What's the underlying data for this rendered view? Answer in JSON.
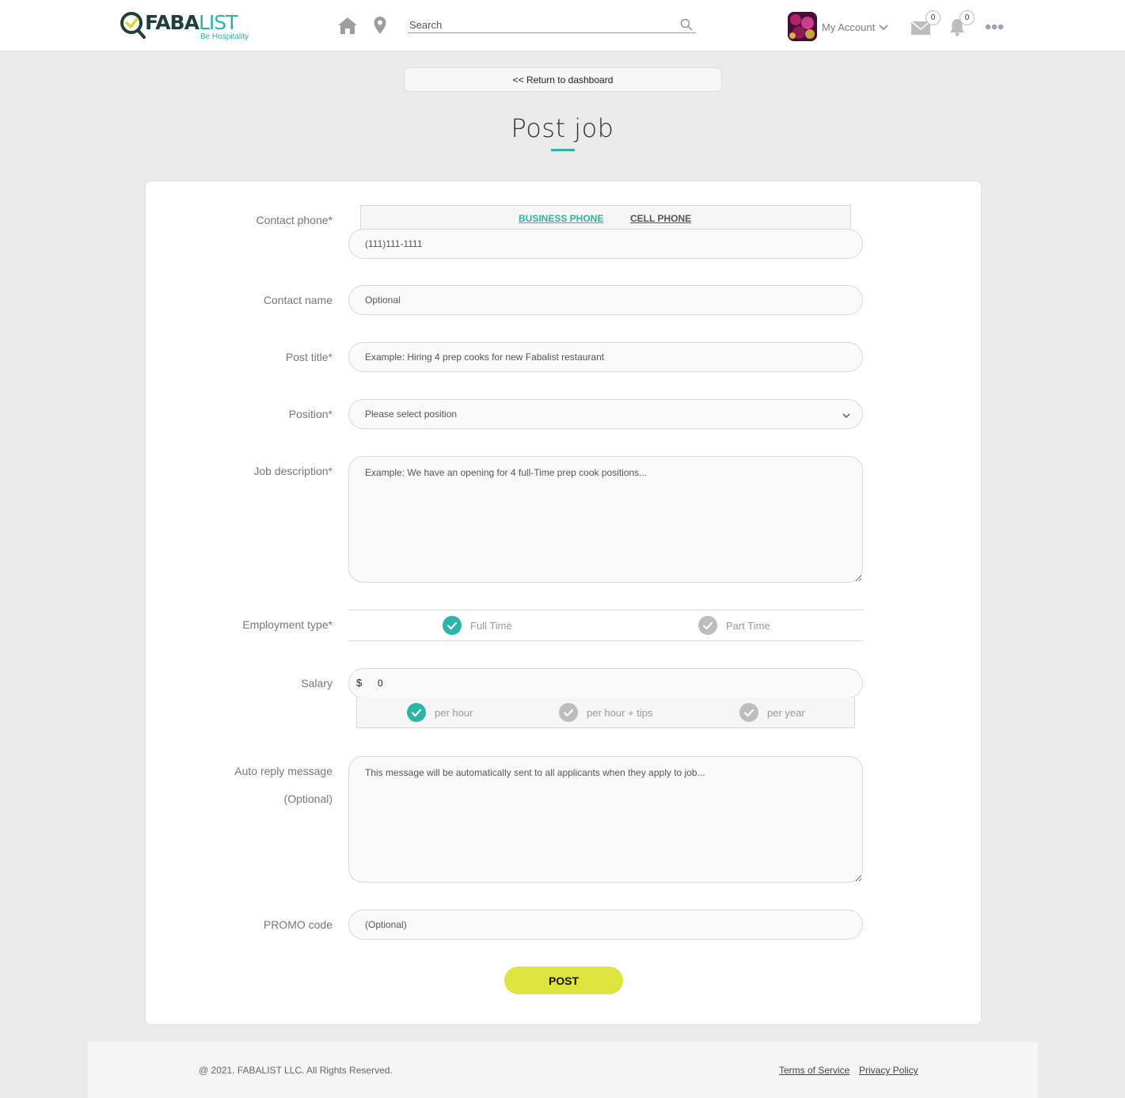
{
  "brand": {
    "name_main": "FABA",
    "name_accent": "LIST",
    "tagline": "Be Hospitality"
  },
  "header": {
    "search_placeholder": "Search",
    "account_label": "My Account",
    "messages_count": "0",
    "notifications_count": "0"
  },
  "return_label": "<< Return to dashboard",
  "page_title": "Post job",
  "form": {
    "contact_phone": {
      "label": "Contact phone*",
      "tabs": [
        "BUSINESS PHONE",
        "CELL PHONE"
      ],
      "active_tab": "BUSINESS PHONE",
      "placeholder": "(111)111-1111"
    },
    "contact_name": {
      "label": "Contact name",
      "placeholder": "Optional"
    },
    "post_title": {
      "label": "Post title*",
      "placeholder": "Example: Hiring 4 prep cooks for new Fabalist restaurant"
    },
    "position": {
      "label": "Position*",
      "selected": "Please select position"
    },
    "job_description": {
      "label": "Job description*",
      "placeholder": "Example: We have an opening for 4 full-Time prep cook positions..."
    },
    "employment_type": {
      "label": "Employment type*",
      "options": [
        {
          "label": "Full Time",
          "selected": true
        },
        {
          "label": "Part Time",
          "selected": false
        }
      ]
    },
    "salary": {
      "label": "Salary",
      "currency": "$",
      "value": "0",
      "rates": [
        {
          "label": "per hour",
          "selected": true
        },
        {
          "label": "per hour + tips",
          "selected": false
        },
        {
          "label": "per year",
          "selected": false
        }
      ]
    },
    "auto_reply": {
      "label_line1": "Auto reply message",
      "label_line2": "(Optional)",
      "placeholder": "This message will be automatically sent to all applicants when they apply to job..."
    },
    "promo_code": {
      "label": "PROMO code",
      "placeholder": "(Optional)"
    },
    "submit_label": "POST"
  },
  "footer": {
    "copyright": "@ 2021. FABALIST LLC. All Rights Reserved.",
    "links": [
      "Terms of Service",
      "Privacy Policy"
    ]
  },
  "colors": {
    "accent": "#2bb5a6",
    "post_button": "#dce43d",
    "unchecked": "#bdbdbd"
  },
  "icons": [
    "home-icon",
    "location-pin-icon",
    "search-icon",
    "chevron-down-icon",
    "mail-icon",
    "bell-icon",
    "more-icon",
    "check-icon"
  ]
}
